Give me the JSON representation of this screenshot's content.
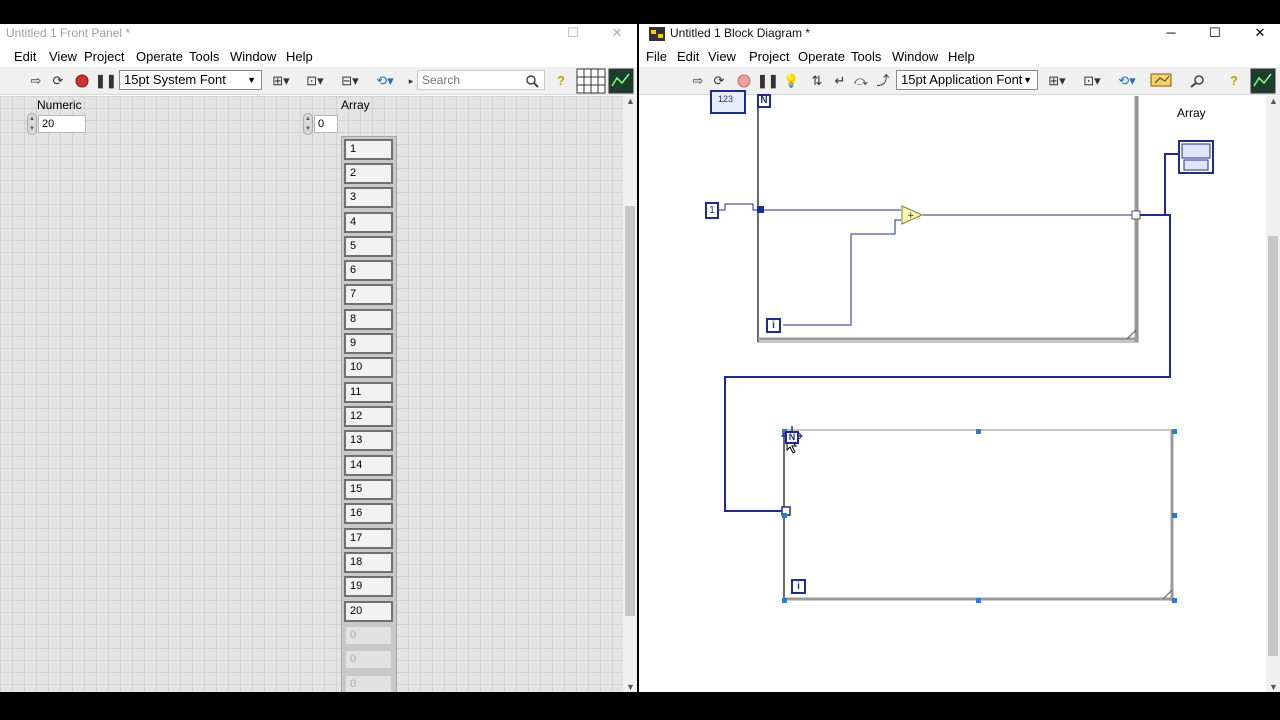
{
  "front_panel": {
    "title": "Untitled 1 Front Panel *",
    "menus": [
      "Edit",
      "View",
      "Project",
      "Operate",
      "Tools",
      "Window",
      "Help"
    ],
    "font_select": "15pt System Font",
    "search_placeholder": "Search",
    "numeric": {
      "label": "Numeric",
      "value": "20"
    },
    "array": {
      "label": "Array",
      "index": "0",
      "elements": [
        "1",
        "2",
        "3",
        "4",
        "5",
        "6",
        "7",
        "8",
        "9",
        "10",
        "11",
        "12",
        "13",
        "14",
        "15",
        "16",
        "17",
        "18",
        "19",
        "20"
      ],
      "empty_elements": [
        "0",
        "0",
        "0"
      ]
    }
  },
  "block_diagram": {
    "title": "Untitled 1 Block Diagram *",
    "menus": [
      "File",
      "Edit",
      "View",
      "Project",
      "Operate",
      "Tools",
      "Window",
      "Help"
    ],
    "font_select": "15pt Application Font",
    "array_indicator_label": "Array",
    "constant_one": "1",
    "loop_count_terminal": "N",
    "iteration_terminal": "i",
    "numeric_terminal_text": "123"
  },
  "icons": {
    "run": "run-arrow-icon",
    "run_continuously": "run-continuously-icon",
    "abort": "abort-icon",
    "pause": "pause-icon",
    "highlight": "highlight-execution-icon",
    "search": "magnifier-icon",
    "help": "help-icon"
  },
  "colors": {
    "wire_blue": "#1f2d8a",
    "panel_grid": "#d2d2d2",
    "add_node": "#fff7b8"
  }
}
